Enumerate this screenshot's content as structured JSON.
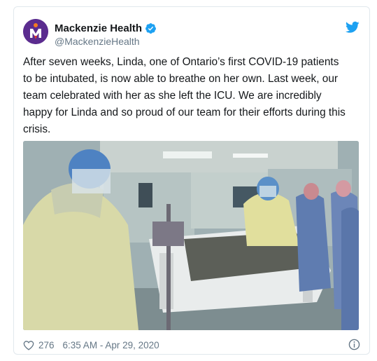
{
  "author": {
    "display_name": "Mackenzie Health",
    "handle": "@MackenzieHealth",
    "verified": true,
    "avatar_icon": "mackenzie-health-logo",
    "brand_color": "#5b2c8f"
  },
  "tweet": {
    "text": "After seven weeks, Linda, one of Ontario’s first COVID-19 patients\nto be intubated, is now able to breathe on her own. Last week, our\nteam celebrated with her as she left the ICU. We are incredibly\nhappy for Linda and so proud of our team for their efforts during this\ncrisis."
  },
  "media": {
    "type": "photo",
    "scene": "icu-hospital-room"
  },
  "footer": {
    "likes": "276",
    "timestamp": "6:35 AM - Apr 29, 2020",
    "heart_icon": "heart-icon",
    "info_icon": "info-icon"
  },
  "colors": {
    "twitter_blue": "#1da1f2",
    "secondary_text": "#657786",
    "border": "#e1e8ed"
  }
}
